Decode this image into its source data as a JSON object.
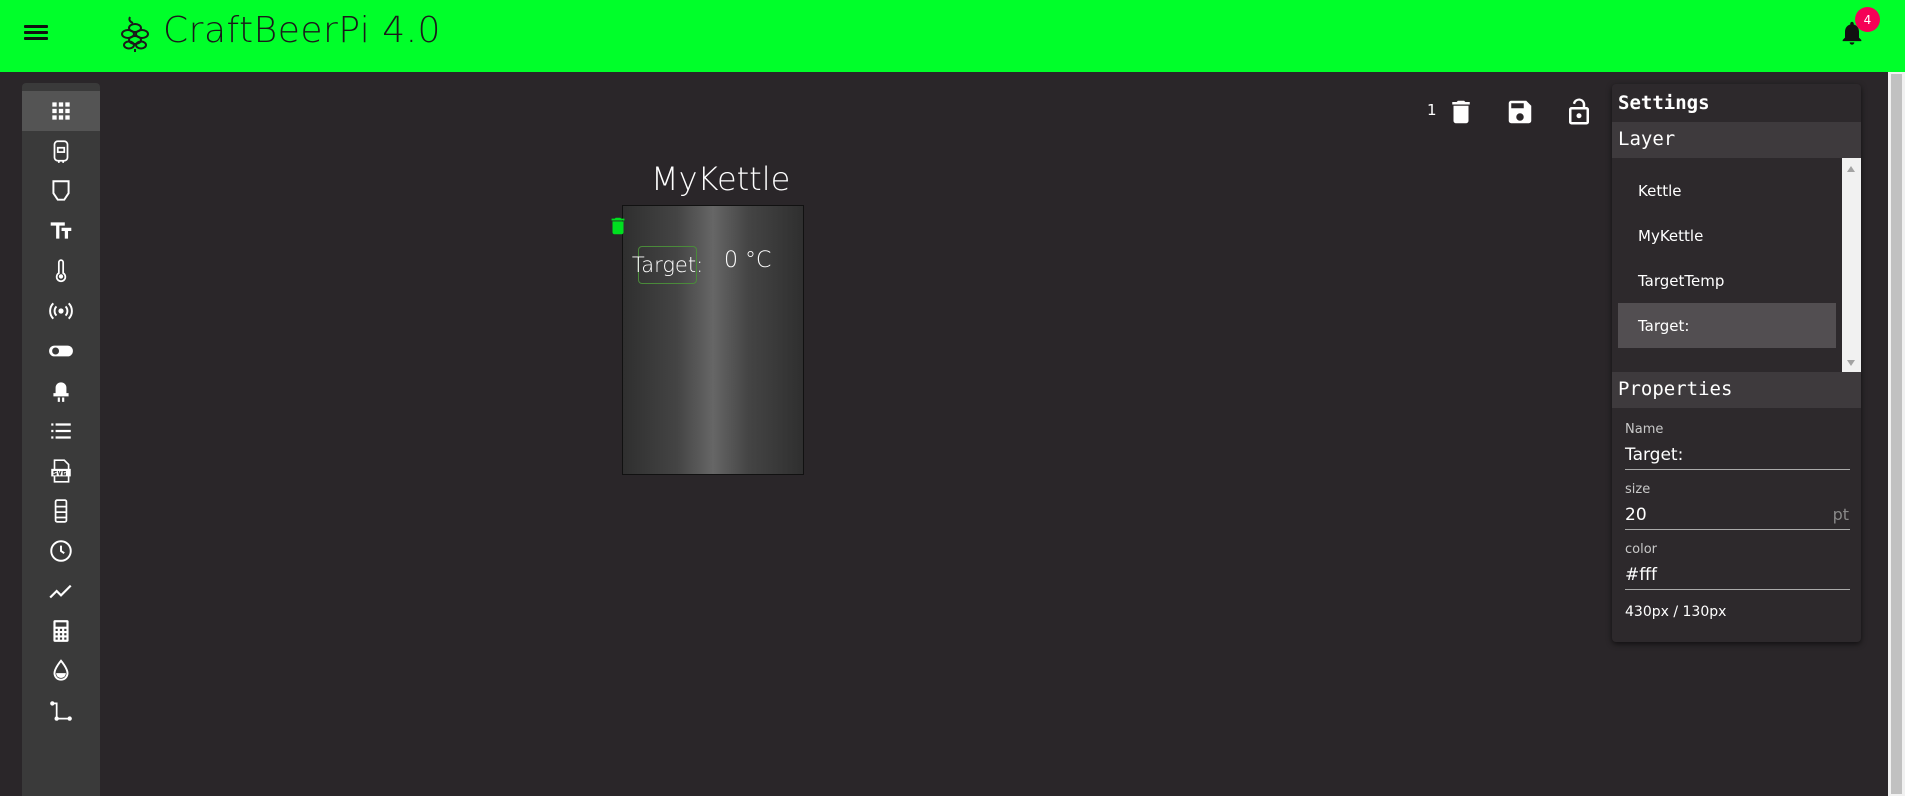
{
  "app": {
    "title": "CraftBeerPi 4.0",
    "notification_count": "4"
  },
  "sidebar": {
    "items": [
      {
        "name": "widgets-grid-icon"
      },
      {
        "name": "fermenter-icon"
      },
      {
        "name": "kettle-icon"
      },
      {
        "name": "text-icon"
      },
      {
        "name": "thermometer-icon"
      },
      {
        "name": "sensor-signal-icon"
      },
      {
        "name": "toggle-switch-icon"
      },
      {
        "name": "led-icon"
      },
      {
        "name": "list-icon"
      },
      {
        "name": "svg-file-icon"
      },
      {
        "name": "tank-icon"
      },
      {
        "name": "clock-icon"
      },
      {
        "name": "chart-line-icon"
      },
      {
        "name": "calculator-icon"
      },
      {
        "name": "water-drop-icon"
      },
      {
        "name": "path-connector-icon"
      }
    ]
  },
  "toolbar": {
    "selected_count": "1"
  },
  "canvas": {
    "kettle_title": "MyKettle",
    "target_label": "Target:",
    "target_temp": "0 °C"
  },
  "settings": {
    "title": "Settings",
    "layer_heading": "Layer",
    "layers": [
      {
        "label": "Kettle"
      },
      {
        "label": "MyKettle"
      },
      {
        "label": "TargetTemp"
      },
      {
        "label": "Target:"
      }
    ],
    "properties_heading": "Properties",
    "name_label": "Name",
    "name_value": "Target:",
    "size_label": "size",
    "size_value": "20",
    "size_unit": "pt",
    "color_label": "color",
    "color_value": "#fff",
    "dimensions": "430px / 130px"
  },
  "colors": {
    "appbar": "#00ff2a",
    "accent_green": "#00e020",
    "badge": "#f50057"
  }
}
